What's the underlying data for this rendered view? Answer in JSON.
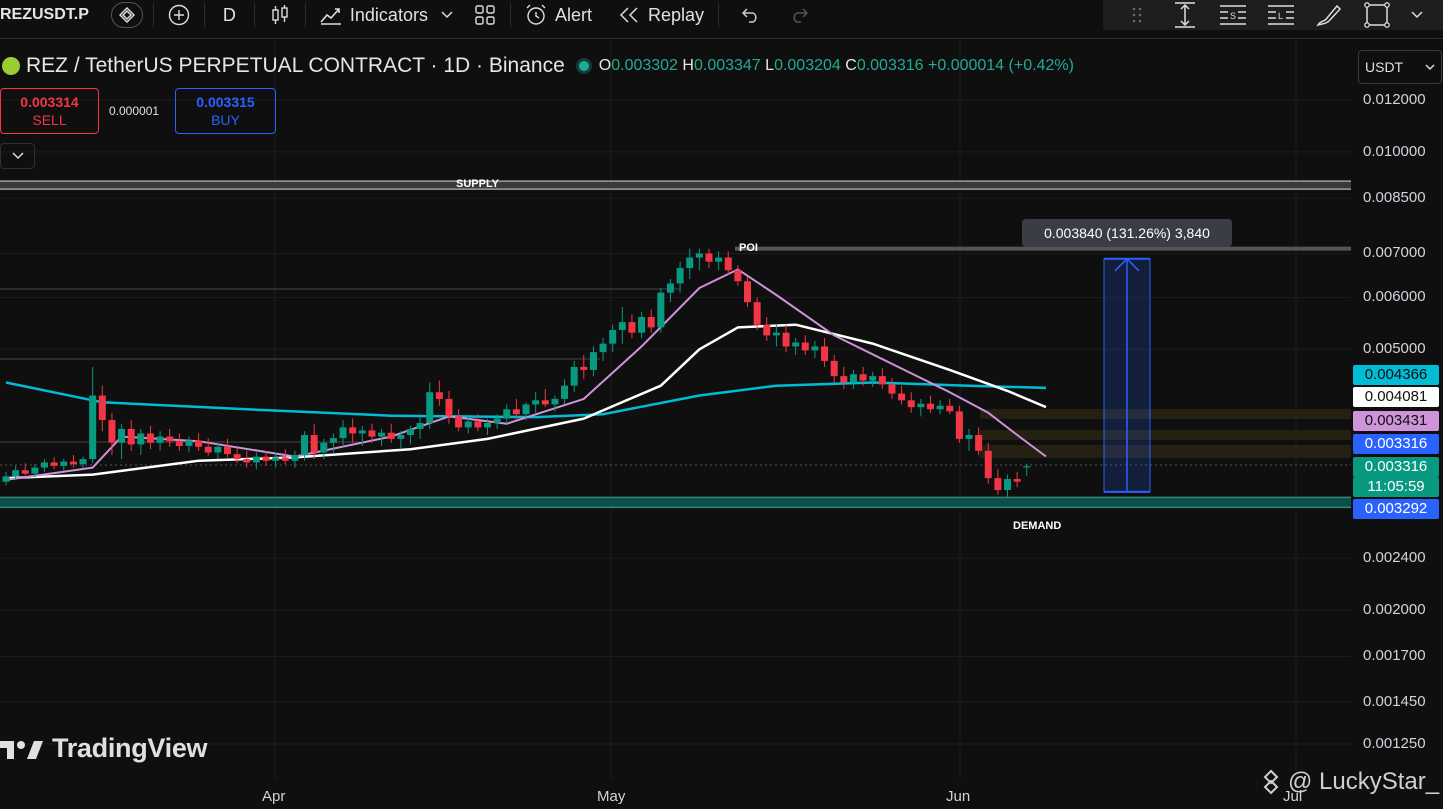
{
  "toolbar": {
    "symbol": "REZUSDT.P",
    "timeframe": "D",
    "indicators_label": "Indicators",
    "alert_label": "Alert",
    "replay_label": "Replay"
  },
  "header": {
    "title": "REZ / TetherUS PERPETUAL CONTRACT · 1D · Binance",
    "ohlc": {
      "o_key": "O",
      "o": "0.003302",
      "h_key": "H",
      "h": "0.003347",
      "l_key": "L",
      "l": "0.003204",
      "c_key": "C",
      "c": "0.003316",
      "change": "+0.000014 (+0.42%)"
    }
  },
  "trade": {
    "sell_price": "0.003314",
    "sell_label": "SELL",
    "spread": "0.000001",
    "buy_price": "0.003315",
    "buy_label": "BUY"
  },
  "price_scale": {
    "currency": "USDT",
    "ticks": [
      "0.012000",
      "0.010000",
      "0.008500",
      "0.007000",
      "0.006000",
      "0.005000",
      "0.002400",
      "0.002000",
      "0.001700",
      "0.001450",
      "0.001250"
    ],
    "labels": [
      {
        "value": "0.004366",
        "bg": "#00bcd4",
        "fg": "#0f0f0f"
      },
      {
        "value": "0.004081",
        "bg": "#ffffff",
        "fg": "#0f0f0f"
      },
      {
        "value": "0.003431",
        "bg": "#ce93d8",
        "fg": "#0f0f0f"
      },
      {
        "value": "0.003316",
        "bg": "#2962ff",
        "fg": "#ffffff"
      },
      {
        "value": "0.003316",
        "bg": "#089981",
        "fg": "#ffffff"
      },
      {
        "value": "11:05:59",
        "bg": "#089981",
        "fg": "#ffffff"
      },
      {
        "value": "0.003292",
        "bg": "#2962ff",
        "fg": "#ffffff"
      }
    ]
  },
  "time_axis": [
    "Apr",
    "May",
    "Jun",
    "Jul"
  ],
  "annotations": {
    "supply": "SUPPLY",
    "demand": "DEMAND",
    "poi": "POI",
    "measure": "0.003840 (131.26%) 3,840"
  },
  "branding": {
    "watermark": "TradingView",
    "credit": "@ LuckyStar_"
  },
  "colors": {
    "up": "#089981",
    "down": "#f23645",
    "ma_cyan": "#00bcd4",
    "ma_white": "#ffffff",
    "ma_pink": "#ce93d8",
    "measure": "#2962ff"
  },
  "chart_data": {
    "type": "candlestick",
    "scale": "log",
    "ylim": [
      0.00125,
      0.012
    ],
    "levels": {
      "supply": 0.0089,
      "poi": 0.00712,
      "demand": 0.00292
    },
    "measure": {
      "from": 0.00303,
      "to": 0.00687
    },
    "candles": [
      {
        "o": 0.00314,
        "h": 0.00325,
        "l": 0.0031,
        "c": 0.0032
      },
      {
        "o": 0.0032,
        "h": 0.00332,
        "l": 0.00316,
        "c": 0.00327
      },
      {
        "o": 0.00327,
        "h": 0.00335,
        "l": 0.00321,
        "c": 0.00323
      },
      {
        "o": 0.00323,
        "h": 0.00334,
        "l": 0.00319,
        "c": 0.0033
      },
      {
        "o": 0.0033,
        "h": 0.0034,
        "l": 0.00325,
        "c": 0.00336
      },
      {
        "o": 0.00336,
        "h": 0.00342,
        "l": 0.00328,
        "c": 0.00332
      },
      {
        "o": 0.00332,
        "h": 0.0034,
        "l": 0.00327,
        "c": 0.00337
      },
      {
        "o": 0.00337,
        "h": 0.00345,
        "l": 0.0033,
        "c": 0.00334
      },
      {
        "o": 0.00334,
        "h": 0.00343,
        "l": 0.00329,
        "c": 0.0034
      },
      {
        "o": 0.0034,
        "h": 0.0047,
        "l": 0.00335,
        "c": 0.00425
      },
      {
        "o": 0.00425,
        "h": 0.0044,
        "l": 0.00375,
        "c": 0.0039
      },
      {
        "o": 0.0039,
        "h": 0.004,
        "l": 0.00345,
        "c": 0.0036
      },
      {
        "o": 0.0036,
        "h": 0.00385,
        "l": 0.0034,
        "c": 0.00378
      },
      {
        "o": 0.00378,
        "h": 0.0039,
        "l": 0.0035,
        "c": 0.00358
      },
      {
        "o": 0.00358,
        "h": 0.00378,
        "l": 0.00345,
        "c": 0.00372
      },
      {
        "o": 0.00372,
        "h": 0.00382,
        "l": 0.00352,
        "c": 0.0036
      },
      {
        "o": 0.0036,
        "h": 0.00375,
        "l": 0.0035,
        "c": 0.00368
      },
      {
        "o": 0.00368,
        "h": 0.00378,
        "l": 0.00355,
        "c": 0.00362
      },
      {
        "o": 0.00362,
        "h": 0.00372,
        "l": 0.0035,
        "c": 0.00356
      },
      {
        "o": 0.00356,
        "h": 0.00368,
        "l": 0.00348,
        "c": 0.00363
      },
      {
        "o": 0.00363,
        "h": 0.00372,
        "l": 0.0035,
        "c": 0.00355
      },
      {
        "o": 0.00355,
        "h": 0.00366,
        "l": 0.00344,
        "c": 0.00348
      },
      {
        "o": 0.00348,
        "h": 0.0036,
        "l": 0.0034,
        "c": 0.00355
      },
      {
        "o": 0.00355,
        "h": 0.00365,
        "l": 0.00342,
        "c": 0.00346
      },
      {
        "o": 0.00346,
        "h": 0.00354,
        "l": 0.00335,
        "c": 0.0034
      },
      {
        "o": 0.0034,
        "h": 0.0035,
        "l": 0.0033,
        "c": 0.00336
      },
      {
        "o": 0.00336,
        "h": 0.00348,
        "l": 0.00328,
        "c": 0.00343
      },
      {
        "o": 0.00343,
        "h": 0.0035,
        "l": 0.00332,
        "c": 0.00338
      },
      {
        "o": 0.00338,
        "h": 0.00348,
        "l": 0.0033,
        "c": 0.00342
      },
      {
        "o": 0.00342,
        "h": 0.00352,
        "l": 0.00334,
        "c": 0.00338
      },
      {
        "o": 0.00338,
        "h": 0.0035,
        "l": 0.0033,
        "c": 0.00345
      },
      {
        "o": 0.00345,
        "h": 0.00375,
        "l": 0.00338,
        "c": 0.0037
      },
      {
        "o": 0.0037,
        "h": 0.00385,
        "l": 0.0034,
        "c": 0.00348
      },
      {
        "o": 0.00348,
        "h": 0.00365,
        "l": 0.0034,
        "c": 0.0036
      },
      {
        "o": 0.0036,
        "h": 0.00372,
        "l": 0.00348,
        "c": 0.00366
      },
      {
        "o": 0.00366,
        "h": 0.0039,
        "l": 0.00355,
        "c": 0.0038
      },
      {
        "o": 0.0038,
        "h": 0.00392,
        "l": 0.0036,
        "c": 0.00372
      },
      {
        "o": 0.00372,
        "h": 0.00382,
        "l": 0.00356,
        "c": 0.00376
      },
      {
        "o": 0.00376,
        "h": 0.00385,
        "l": 0.0036,
        "c": 0.00368
      },
      {
        "o": 0.00368,
        "h": 0.00378,
        "l": 0.00356,
        "c": 0.00373
      },
      {
        "o": 0.00373,
        "h": 0.00385,
        "l": 0.0036,
        "c": 0.00365
      },
      {
        "o": 0.00365,
        "h": 0.00375,
        "l": 0.00352,
        "c": 0.0037
      },
      {
        "o": 0.0037,
        "h": 0.00382,
        "l": 0.00358,
        "c": 0.00378
      },
      {
        "o": 0.00378,
        "h": 0.00395,
        "l": 0.00365,
        "c": 0.00386
      },
      {
        "o": 0.00386,
        "h": 0.00445,
        "l": 0.00378,
        "c": 0.0043
      },
      {
        "o": 0.0043,
        "h": 0.00448,
        "l": 0.0041,
        "c": 0.0042
      },
      {
        "o": 0.0042,
        "h": 0.00432,
        "l": 0.00385,
        "c": 0.00395
      },
      {
        "o": 0.00395,
        "h": 0.00405,
        "l": 0.00375,
        "c": 0.0038
      },
      {
        "o": 0.0038,
        "h": 0.00395,
        "l": 0.00372,
        "c": 0.00388
      },
      {
        "o": 0.00388,
        "h": 0.00398,
        "l": 0.00375,
        "c": 0.0038
      },
      {
        "o": 0.0038,
        "h": 0.00392,
        "l": 0.0037,
        "c": 0.00386
      },
      {
        "o": 0.00386,
        "h": 0.00398,
        "l": 0.00378,
        "c": 0.00392
      },
      {
        "o": 0.00392,
        "h": 0.00412,
        "l": 0.00385,
        "c": 0.00405
      },
      {
        "o": 0.00405,
        "h": 0.0042,
        "l": 0.0039,
        "c": 0.00398
      },
      {
        "o": 0.00398,
        "h": 0.00415,
        "l": 0.0039,
        "c": 0.00412
      },
      {
        "o": 0.00412,
        "h": 0.0043,
        "l": 0.004,
        "c": 0.00418
      },
      {
        "o": 0.00418,
        "h": 0.00435,
        "l": 0.00408,
        "c": 0.00412
      },
      {
        "o": 0.00412,
        "h": 0.00425,
        "l": 0.00402,
        "c": 0.0042
      },
      {
        "o": 0.0042,
        "h": 0.0045,
        "l": 0.00412,
        "c": 0.0044
      },
      {
        "o": 0.0044,
        "h": 0.0048,
        "l": 0.0043,
        "c": 0.0047
      },
      {
        "o": 0.0047,
        "h": 0.0049,
        "l": 0.0045,
        "c": 0.00465
      },
      {
        "o": 0.00465,
        "h": 0.00505,
        "l": 0.00455,
        "c": 0.00495
      },
      {
        "o": 0.00495,
        "h": 0.0052,
        "l": 0.0048,
        "c": 0.0051
      },
      {
        "o": 0.0051,
        "h": 0.00545,
        "l": 0.00495,
        "c": 0.00535
      },
      {
        "o": 0.00535,
        "h": 0.0058,
        "l": 0.0051,
        "c": 0.0055
      },
      {
        "o": 0.0055,
        "h": 0.00565,
        "l": 0.0052,
        "c": 0.0053
      },
      {
        "o": 0.0053,
        "h": 0.0057,
        "l": 0.0052,
        "c": 0.0056
      },
      {
        "o": 0.0056,
        "h": 0.00575,
        "l": 0.0053,
        "c": 0.0054
      },
      {
        "o": 0.0054,
        "h": 0.0062,
        "l": 0.0053,
        "c": 0.0061
      },
      {
        "o": 0.0061,
        "h": 0.0064,
        "l": 0.0059,
        "c": 0.0063
      },
      {
        "o": 0.0063,
        "h": 0.0068,
        "l": 0.0061,
        "c": 0.00665
      },
      {
        "o": 0.00665,
        "h": 0.00712,
        "l": 0.0064,
        "c": 0.0069
      },
      {
        "o": 0.0069,
        "h": 0.00712,
        "l": 0.0066,
        "c": 0.007
      },
      {
        "o": 0.007,
        "h": 0.00712,
        "l": 0.00665,
        "c": 0.0068
      },
      {
        "o": 0.0068,
        "h": 0.00705,
        "l": 0.0066,
        "c": 0.0069
      },
      {
        "o": 0.0069,
        "h": 0.00705,
        "l": 0.0065,
        "c": 0.0066
      },
      {
        "o": 0.0066,
        "h": 0.00672,
        "l": 0.00625,
        "c": 0.00635
      },
      {
        "o": 0.00635,
        "h": 0.00645,
        "l": 0.0058,
        "c": 0.0059
      },
      {
        "o": 0.0059,
        "h": 0.006,
        "l": 0.00535,
        "c": 0.00545
      },
      {
        "o": 0.00545,
        "h": 0.0056,
        "l": 0.00515,
        "c": 0.00525
      },
      {
        "o": 0.00525,
        "h": 0.00545,
        "l": 0.00505,
        "c": 0.0053
      },
      {
        "o": 0.0053,
        "h": 0.00545,
        "l": 0.00495,
        "c": 0.00505
      },
      {
        "o": 0.00505,
        "h": 0.0052,
        "l": 0.0049,
        "c": 0.00512
      },
      {
        "o": 0.00512,
        "h": 0.00525,
        "l": 0.0049,
        "c": 0.00498
      },
      {
        "o": 0.00498,
        "h": 0.00515,
        "l": 0.00485,
        "c": 0.00505
      },
      {
        "o": 0.00505,
        "h": 0.0052,
        "l": 0.0047,
        "c": 0.0048
      },
      {
        "o": 0.0048,
        "h": 0.0049,
        "l": 0.00445,
        "c": 0.00455
      },
      {
        "o": 0.00455,
        "h": 0.0047,
        "l": 0.00435,
        "c": 0.00445
      },
      {
        "o": 0.00445,
        "h": 0.00465,
        "l": 0.00435,
        "c": 0.00458
      },
      {
        "o": 0.00458,
        "h": 0.0047,
        "l": 0.0044,
        "c": 0.00448
      },
      {
        "o": 0.00448,
        "h": 0.00462,
        "l": 0.00438,
        "c": 0.00455
      },
      {
        "o": 0.00455,
        "h": 0.00468,
        "l": 0.00435,
        "c": 0.00442
      },
      {
        "o": 0.00442,
        "h": 0.00452,
        "l": 0.0042,
        "c": 0.00428
      },
      {
        "o": 0.00428,
        "h": 0.0044,
        "l": 0.00412,
        "c": 0.00418
      },
      {
        "o": 0.00418,
        "h": 0.0043,
        "l": 0.004,
        "c": 0.00408
      },
      {
        "o": 0.00408,
        "h": 0.0042,
        "l": 0.00395,
        "c": 0.00413
      },
      {
        "o": 0.00413,
        "h": 0.00425,
        "l": 0.004,
        "c": 0.00405
      },
      {
        "o": 0.00405,
        "h": 0.00418,
        "l": 0.00398,
        "c": 0.0041
      },
      {
        "o": 0.0041,
        "h": 0.0042,
        "l": 0.00398,
        "c": 0.00402
      },
      {
        "o": 0.00402,
        "h": 0.0041,
        "l": 0.0036,
        "c": 0.00365
      },
      {
        "o": 0.00365,
        "h": 0.00378,
        "l": 0.0035,
        "c": 0.0037
      },
      {
        "o": 0.0037,
        "h": 0.0038,
        "l": 0.00345,
        "c": 0.0035
      },
      {
        "o": 0.0035,
        "h": 0.0036,
        "l": 0.00312,
        "c": 0.00318
      },
      {
        "o": 0.00318,
        "h": 0.00328,
        "l": 0.003,
        "c": 0.00305
      },
      {
        "o": 0.00305,
        "h": 0.00322,
        "l": 0.00298,
        "c": 0.00317
      },
      {
        "o": 0.00317,
        "h": 0.00325,
        "l": 0.00308,
        "c": 0.00314
      },
      {
        "o": 0.003302,
        "h": 0.003347,
        "l": 0.003204,
        "c": 0.003316
      }
    ],
    "ma_cyan": [
      [
        0,
        0.00445
      ],
      [
        10,
        0.00415
      ],
      [
        25,
        0.00405
      ],
      [
        40,
        0.00396
      ],
      [
        55,
        0.00394
      ],
      [
        62,
        0.00398
      ],
      [
        72,
        0.00425
      ],
      [
        80,
        0.0044
      ],
      [
        90,
        0.00445
      ],
      [
        100,
        0.0044
      ],
      [
        108,
        0.004366
      ]
    ],
    "ma_white": [
      [
        0,
        0.00318
      ],
      [
        9,
        0.00322
      ],
      [
        20,
        0.00338
      ],
      [
        30,
        0.00342
      ],
      [
        42,
        0.00352
      ],
      [
        50,
        0.00365
      ],
      [
        60,
        0.00392
      ],
      [
        68,
        0.0044
      ],
      [
        72,
        0.005
      ],
      [
        76,
        0.0054
      ],
      [
        82,
        0.00545
      ],
      [
        90,
        0.0051
      ],
      [
        98,
        0.00465
      ],
      [
        104,
        0.00432
      ],
      [
        108,
        0.004081
      ]
    ],
    "ma_pink": [
      [
        0,
        0.00316
      ],
      [
        9,
        0.0033
      ],
      [
        12,
        0.00368
      ],
      [
        20,
        0.00362
      ],
      [
        30,
        0.00343
      ],
      [
        40,
        0.00368
      ],
      [
        46,
        0.00395
      ],
      [
        52,
        0.00385
      ],
      [
        60,
        0.0042
      ],
      [
        66,
        0.00505
      ],
      [
        72,
        0.0062
      ],
      [
        76,
        0.00662
      ],
      [
        80,
        0.00605
      ],
      [
        86,
        0.00525
      ],
      [
        92,
        0.00475
      ],
      [
        98,
        0.0043
      ],
      [
        102,
        0.004
      ],
      [
        105,
        0.0037
      ],
      [
        108,
        0.003431
      ]
    ]
  }
}
